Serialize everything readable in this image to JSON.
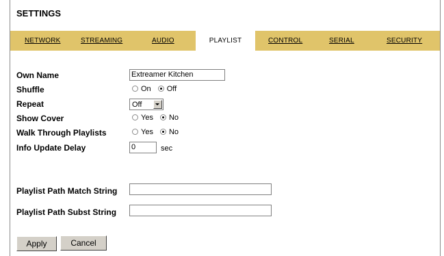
{
  "title": "SETTINGS",
  "tabs": [
    {
      "label": "NETWORK"
    },
    {
      "label": "STREAMING"
    },
    {
      "label": "AUDIO"
    },
    {
      "label": "PLAYLIST"
    },
    {
      "label": "CONTROL"
    },
    {
      "label": "SERIAL"
    },
    {
      "label": "SECURITY"
    }
  ],
  "active_tab": "PLAYLIST",
  "form": {
    "own_name": {
      "label": "Own Name",
      "value": "Extreamer Kitchen"
    },
    "shuffle": {
      "label": "Shuffle",
      "options": [
        "On",
        "Off"
      ],
      "selected": "Off"
    },
    "repeat": {
      "label": "Repeat",
      "value": "Off"
    },
    "show_cover": {
      "label": "Show Cover",
      "options": [
        "Yes",
        "No"
      ],
      "selected": "No"
    },
    "walk_through": {
      "label": "Walk Through Playlists",
      "options": [
        "Yes",
        "No"
      ],
      "selected": "No"
    },
    "info_delay": {
      "label": "Info Update Delay",
      "value": "0",
      "unit": "sec"
    },
    "path_match": {
      "label": "Playlist Path Match String",
      "value": ""
    },
    "path_subst": {
      "label": "Playlist Path Subst String",
      "value": ""
    }
  },
  "buttons": {
    "apply": "Apply",
    "cancel": "Cancel"
  },
  "colors": {
    "tabbar": "#e0c46a",
    "active_tab": "#ffffff"
  }
}
